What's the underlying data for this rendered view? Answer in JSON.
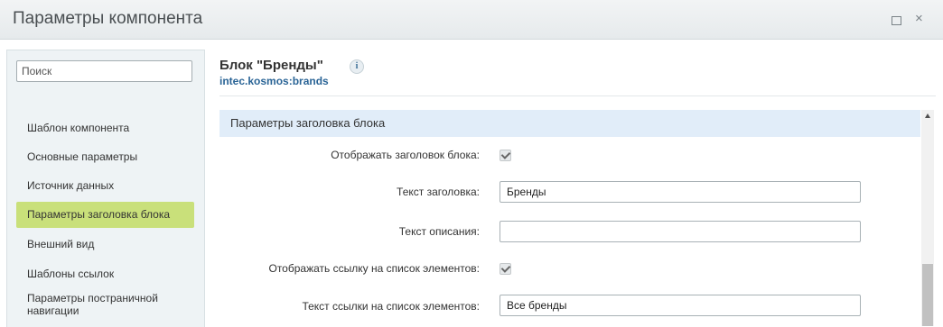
{
  "window": {
    "title": "Параметры компонента",
    "maximize_label": "□",
    "close_label": "×"
  },
  "sidebar": {
    "search_placeholder": "Поиск",
    "items": [
      {
        "label": "Шаблон компонента",
        "active": false
      },
      {
        "label": "Основные параметры",
        "active": false
      },
      {
        "label": "Источник данных",
        "active": false
      },
      {
        "label": "Параметры заголовка блока",
        "active": true
      },
      {
        "label": "Внешний вид",
        "active": false
      },
      {
        "label": "Шаблоны ссылок",
        "active": false
      },
      {
        "label": "Параметры постраничной навигации",
        "active": false
      }
    ]
  },
  "main": {
    "block_title": "Блок \"Бренды\"",
    "block_code": "intec.kosmos:brands",
    "info_icon": "i",
    "section_title": "Параметры заголовка блока",
    "fields": {
      "show_header": {
        "label": "Отображать заголовок блока:",
        "checked": true
      },
      "header_text": {
        "label": "Текст заголовка:",
        "value": "Бренды"
      },
      "description_text": {
        "label": "Текст описания:",
        "value": ""
      },
      "show_list_link": {
        "label": "Отображать ссылку на список элементов:",
        "checked": true
      },
      "list_link_text": {
        "label": "Текст ссылки на список элементов:",
        "value": "Все бренды"
      }
    }
  },
  "colors": {
    "active_item": "#c9e07a",
    "section_header": "#e1edf9",
    "link": "#2a6496"
  }
}
